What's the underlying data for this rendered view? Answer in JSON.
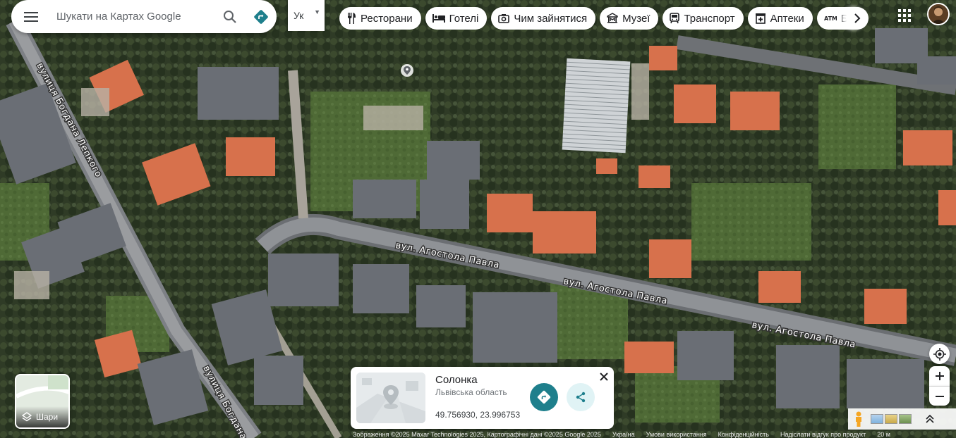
{
  "search": {
    "placeholder": "Шукати на Картах Google"
  },
  "language": {
    "selected": "Ук"
  },
  "categories": [
    {
      "label": "Ресторани",
      "icon": "restaurant-icon"
    },
    {
      "label": "Готелі",
      "icon": "hotel-icon"
    },
    {
      "label": "Чим зайнятися",
      "icon": "camera-icon"
    },
    {
      "label": "Музеї",
      "icon": "museum-icon"
    },
    {
      "label": "Транспорт",
      "icon": "transit-icon"
    },
    {
      "label": "Аптеки",
      "icon": "pharmacy-icon"
    },
    {
      "label": "Бан",
      "icon": "atm-icon"
    }
  ],
  "map": {
    "streets": [
      {
        "name": "вул. Агостола Павла"
      },
      {
        "name": "вул. Агостола Павла"
      },
      {
        "name": "вул. Агостола Павла"
      },
      {
        "name": "вулиця Богдана Лепкого"
      },
      {
        "name": "вулиця Богдана Л"
      }
    ]
  },
  "layers": {
    "label": "Шари"
  },
  "place": {
    "name": "Солонка",
    "region": "Львівська область",
    "coordinates": "49.756930, 23.996753"
  },
  "footer": {
    "items": [
      "Зображення ©2025 Maxar Technologies 2025, Картографічні дані ©2025 Google 2025",
      "Україна",
      "Умови використання",
      "Конфіденційність",
      "Надіслати відгук про продукт",
      "20 м"
    ]
  },
  "colors": {
    "accent": "#1e7f8c",
    "card_bg": "#ffffff"
  }
}
